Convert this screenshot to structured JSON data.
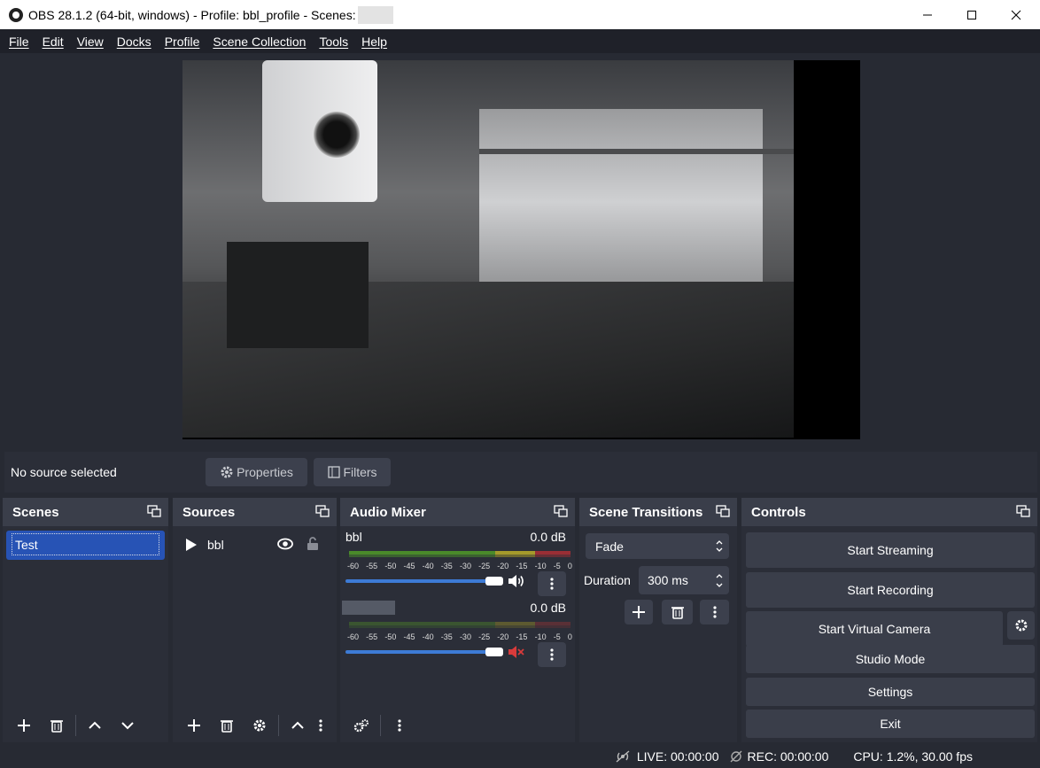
{
  "window": {
    "title": "OBS 28.1.2 (64-bit, windows) - Profile: bbl_profile - Scenes:",
    "minimize": "minimize",
    "maximize": "maximize",
    "close": "close"
  },
  "menu": [
    "File",
    "Edit",
    "View",
    "Docks",
    "Profile",
    "Scene Collection",
    "Tools",
    "Help"
  ],
  "source_toolbar": {
    "status": "No source selected",
    "properties": "Properties",
    "filters": "Filters"
  },
  "scenes": {
    "title": "Scenes",
    "items": [
      "Test"
    ]
  },
  "sources": {
    "title": "Sources",
    "items": [
      {
        "name": "bbl",
        "visible": true,
        "locked": false
      }
    ]
  },
  "mixer": {
    "title": "Audio Mixer",
    "ticks": [
      "-60",
      "-55",
      "-50",
      "-45",
      "-40",
      "-35",
      "-30",
      "-25",
      "-20",
      "-15",
      "-10",
      "-5",
      "0"
    ],
    "tracks": [
      {
        "name": "bbl",
        "db": "0.0 dB",
        "muted": false,
        "volume": 1.0
      },
      {
        "name": "",
        "db": "0.0 dB",
        "muted": true,
        "volume": 1.0
      }
    ]
  },
  "transitions": {
    "title": "Scene Transitions",
    "selected": "Fade",
    "duration_label": "Duration",
    "duration_value": "300 ms"
  },
  "controls": {
    "title": "Controls",
    "start_streaming": "Start Streaming",
    "start_recording": "Start Recording",
    "start_virtual_camera": "Start Virtual Camera",
    "studio_mode": "Studio Mode",
    "settings": "Settings",
    "exit": "Exit"
  },
  "status": {
    "live": "LIVE: 00:00:00",
    "rec": "REC: 00:00:00",
    "cpu": "CPU: 1.2%, 30.00 fps"
  },
  "colors": {
    "accent": "#2753b5",
    "dock_bg": "#2b2e38",
    "dock_header": "#3a3e4a",
    "button": "#3c404d",
    "meter_green": "#4a8a2a",
    "meter_yellow": "#a59a2b",
    "meter_red": "#9a2e35",
    "muted_red": "#d93b3b"
  }
}
